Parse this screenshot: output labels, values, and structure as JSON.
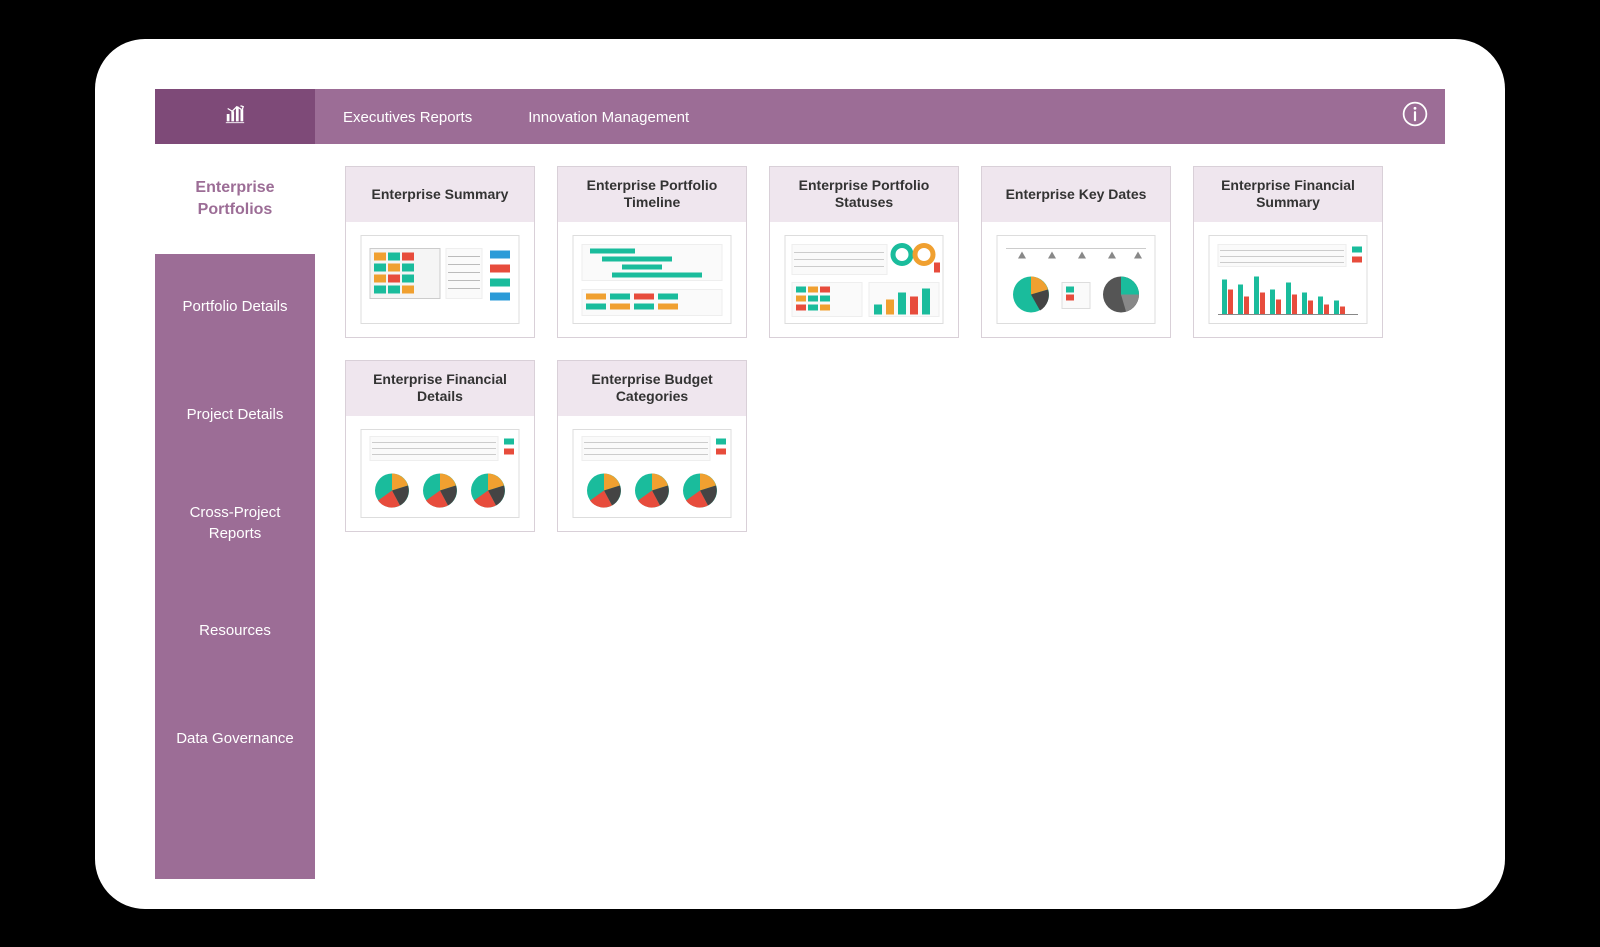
{
  "colors": {
    "brand_primary": "#9c6d96",
    "brand_dark": "#7e4a78",
    "card_header": "#efe6ee"
  },
  "topbar": {
    "tabs": [
      "Executives Reports",
      "Innovation Management"
    ]
  },
  "sidebar": {
    "active": "Enterprise Portfolios",
    "items": [
      "Portfolio Details",
      "Project Details",
      "Cross-Project Reports",
      "Resources",
      "Data Governance"
    ]
  },
  "reports": {
    "cards": [
      {
        "title": "Enterprise Summary",
        "thumb_type": "grid"
      },
      {
        "title": "Enterprise Portfolio Timeline",
        "thumb_type": "gantt"
      },
      {
        "title": "Enterprise Portfolio Statuses",
        "thumb_type": "status"
      },
      {
        "title": "Enterprise Key Dates",
        "thumb_type": "kpi"
      },
      {
        "title": "Enterprise Financial Summary",
        "thumb_type": "bars"
      },
      {
        "title": "Enterprise Financial Details",
        "thumb_type": "pies"
      },
      {
        "title": "Enterprise Budget Categories",
        "thumb_type": "pies"
      }
    ]
  }
}
